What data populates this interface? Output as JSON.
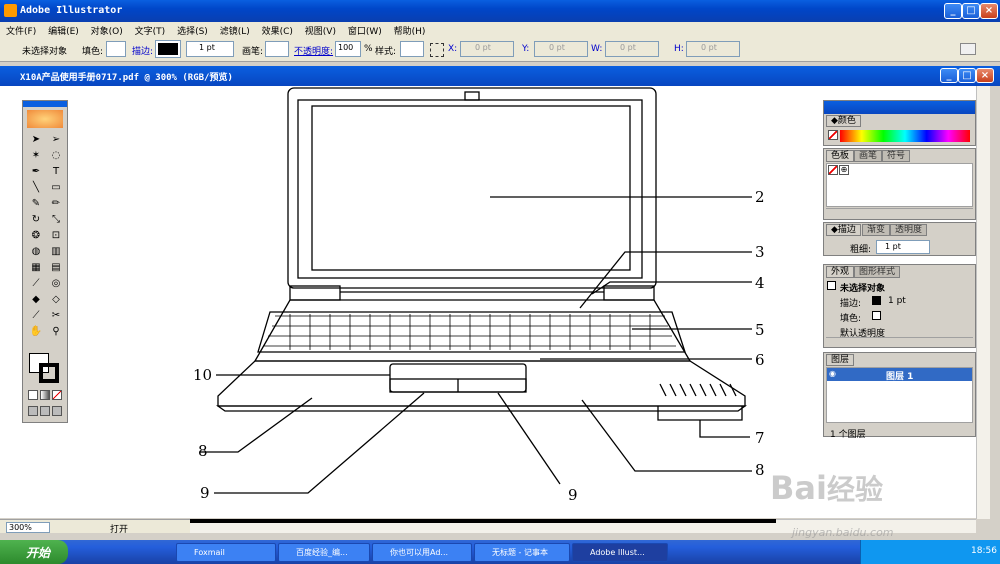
{
  "window": {
    "title": "Adobe Illustrator"
  },
  "menu": [
    "文件(F)",
    "编辑(E)",
    "对象(O)",
    "文字(T)",
    "选择(S)",
    "滤镜(L)",
    "效果(C)",
    "视图(V)",
    "窗口(W)",
    "帮助(H)"
  ],
  "control": {
    "selection": "未选择对象",
    "fill": "填色:",
    "stroke": "描边:",
    "stroke_weight": "1 pt",
    "brush": "画笔:",
    "opacity_label": "不透明度:",
    "opacity_value": "100",
    "percent": "%",
    "style": "样式:",
    "x_label": "X:",
    "x_value": "0 pt",
    "y_label": "Y:",
    "y_value": "0 pt",
    "w_label": "W:",
    "w_value": "0 pt",
    "h_label": "H:",
    "h_value": "0 pt"
  },
  "document": {
    "title": "X10A产品使用手册0717.pdf @ 300% (RGB/预览)"
  },
  "callouts": [
    "2",
    "3",
    "4",
    "5",
    "6",
    "7",
    "8",
    "8",
    "9",
    "9",
    "10"
  ],
  "panels": {
    "color": {
      "tab": "颜色"
    },
    "swatches": {
      "tabs": [
        "色板",
        "画笔",
        "符号"
      ]
    },
    "stroke": {
      "tabs": [
        "描边",
        "渐变",
        "透明度"
      ],
      "weight_label": "粗细:",
      "weight_value": "1 pt"
    },
    "appearance": {
      "tabs": [
        "外观",
        "图形样式"
      ],
      "title": "未选择对象",
      "stroke_label": "描边:",
      "stroke_value": "1 pt",
      "fill_label": "填色:",
      "opacity": "默认透明度"
    },
    "layers": {
      "tab": "图层",
      "layer_name": "图层 1",
      "footer": "1 个图层"
    }
  },
  "status": {
    "zoom": "300%",
    "state": "打开"
  },
  "taskbar": {
    "start": "开始",
    "tasks": [
      "Foxmail",
      "百度经验_编...",
      "你也可以用Ad...",
      "无标题 - 记事本",
      "Adobe Illust..."
    ],
    "clock": "18:56"
  },
  "watermark": {
    "brand": "Bai",
    "brand2": "经验",
    "url": "jingyan.baidu.com"
  }
}
